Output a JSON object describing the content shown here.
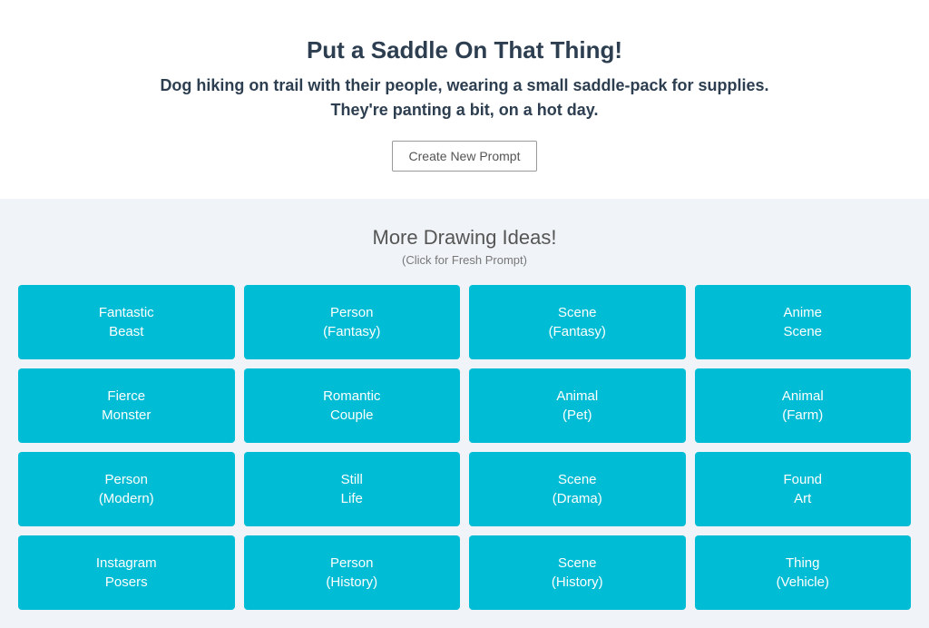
{
  "hero": {
    "title": "Put a Saddle On That Thing!",
    "subtitle_line1": "Dog hiking on trail with their people, wearing a small saddle-pack for supplies.",
    "subtitle_line2": "They're panting a bit, on a hot day.",
    "create_button_label": "Create New Prompt"
  },
  "drawing_section": {
    "title": "More Drawing Ideas!",
    "subtitle": "(Click for Fresh Prompt)",
    "grid_items": [
      {
        "line1": "Fantastic",
        "line2": "Beast"
      },
      {
        "line1": "Person",
        "line2": "(Fantasy)"
      },
      {
        "line1": "Scene",
        "line2": "(Fantasy)"
      },
      {
        "line1": "Anime",
        "line2": "Scene"
      },
      {
        "line1": "Fierce",
        "line2": "Monster"
      },
      {
        "line1": "Romantic",
        "line2": "Couple"
      },
      {
        "line1": "Animal",
        "line2": "(Pet)"
      },
      {
        "line1": "Animal",
        "line2": "(Farm)"
      },
      {
        "line1": "Person",
        "line2": "(Modern)"
      },
      {
        "line1": "Still",
        "line2": "Life"
      },
      {
        "line1": "Scene",
        "line2": "(Drama)"
      },
      {
        "line1": "Found",
        "line2": "Art"
      },
      {
        "line1": "Instagram",
        "line2": "Posers"
      },
      {
        "line1": "Person",
        "line2": "(History)"
      },
      {
        "line1": "Scene",
        "line2": "(History)"
      },
      {
        "line1": "Thing",
        "line2": "(Vehicle)"
      }
    ]
  }
}
